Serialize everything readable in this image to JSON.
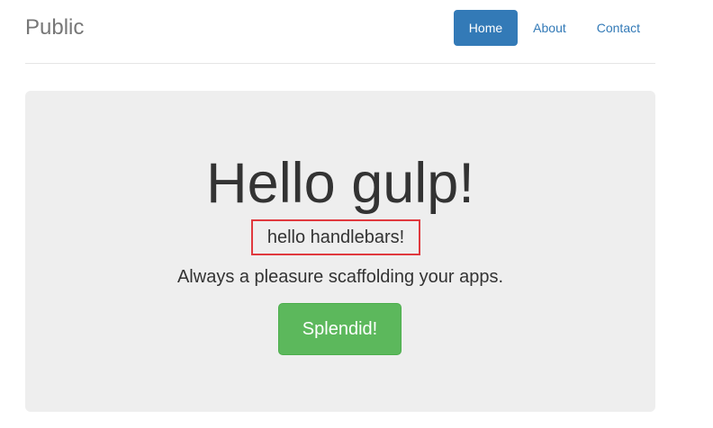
{
  "header": {
    "brand": "Public",
    "nav": [
      {
        "label": "Home",
        "active": true
      },
      {
        "label": "About",
        "active": false
      },
      {
        "label": "Contact",
        "active": false
      }
    ]
  },
  "jumbotron": {
    "title": "Hello gulp!",
    "highlight_text": "hello handlebars!",
    "lead": "Always a pleasure scaffolding your apps.",
    "button_label": "Splendid!"
  },
  "colors": {
    "primary": "#337ab7",
    "success": "#5cb85c",
    "highlight_border": "#e0393e",
    "jumbotron_bg": "#eeeeee"
  }
}
